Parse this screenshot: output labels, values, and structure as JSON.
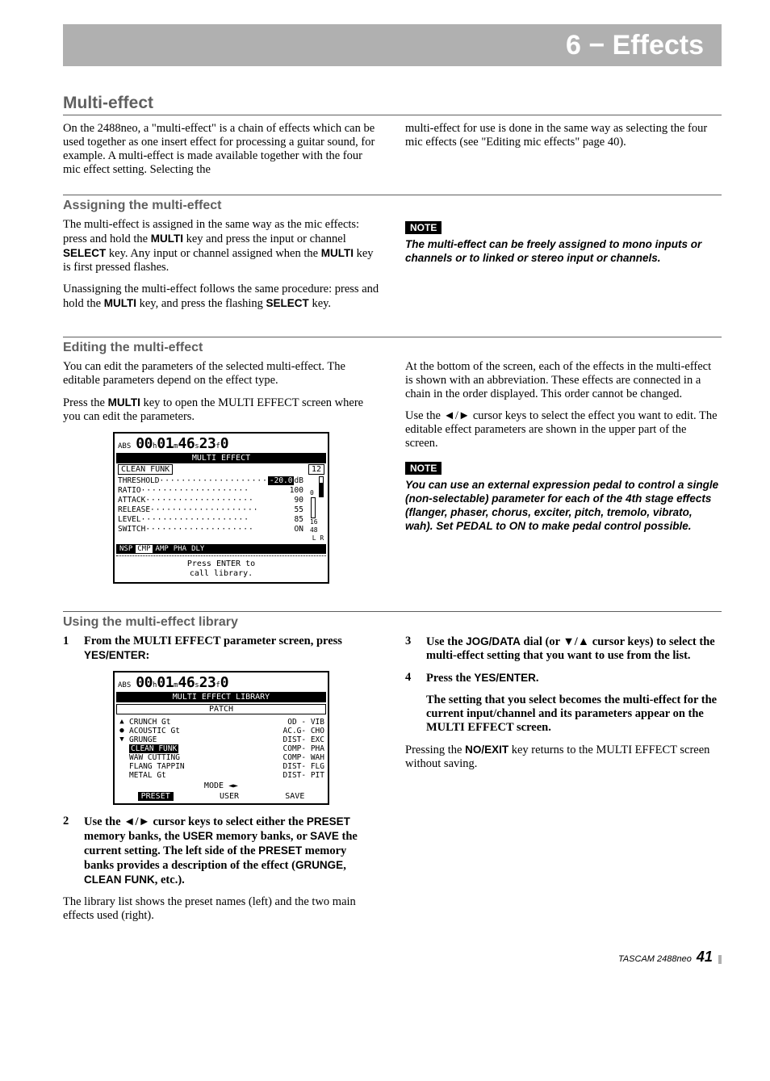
{
  "chapter": "6 − Effects",
  "section_multi": {
    "title": "Multi-effect",
    "p1": "On the 2488neo, a \"multi-effect\" is a chain of effects which can be used together as one insert effect for processing a guitar sound, for example. A multi-effect is made available together with the four mic effect setting. Selecting the",
    "p2": "multi-effect for use is done in the same way as selecting the four mic effects (see \"Editing mic effects\" page 40)."
  },
  "section_assign": {
    "title": "Assigning the multi-effect",
    "p1a": "The multi-effect is assigned in the same way as the mic effects: press and hold the ",
    "p1b": " key and press the input or channel ",
    "p1c": " key. Any input or channel assigned when the ",
    "p1d": " key is first pressed flashes.",
    "p2a": "Unassigning the multi-effect follows the same procedure: press and hold the ",
    "p2b": " key, and press the flashing ",
    "p2c": " key.",
    "k_multi": "MULTI",
    "k_select": "SELECT",
    "note_label": "NOTE",
    "note": "The multi-effect can be freely assigned to mono inputs or channels or to linked or stereo input or channels."
  },
  "section_edit": {
    "title": "Editing the multi-effect",
    "p1": "You can edit the parameters of the selected multi-effect. The editable parameters depend on the effect type.",
    "p2a": "Press the ",
    "p2b": " key to open the MULTI EFFECT screen where you can edit the parameters.",
    "k_multi": "MULTI",
    "p3": "At the bottom of the screen, each of the effects in the multi-effect is shown with an abbreviation. These effects are connected in a chain in the order displayed. This order cannot be changed.",
    "p4": "Use the ◄/► cursor keys to select the effect you want to edit. The editable effect parameters are shown in the upper part of the screen.",
    "note_label": "NOTE",
    "note": "You can use an external expression pedal to control a single (non-selectable) parameter for each of the 4th stage effects (flanger, phaser, chorus, exciter, pitch, tremolo, vibrato, wah). Set PEDAL to ON to make pedal control possible."
  },
  "section_lib": {
    "title": "Using the multi-effect library",
    "step1a": "From the MULTI EFFECT parameter screen, press ",
    "step1b": ":",
    "k_yes": "YES/ENTER",
    "step2a": "Use the ◄/► cursor keys to select either the ",
    "step2b": " memory banks, the ",
    "step2c": " memory banks, or ",
    "step2d": " the current setting. The left side of the ",
    "step2e": " memory banks provides a description of the effect (",
    "step2f": ", etc.).",
    "k_preset": "PRESET",
    "k_user": "USER",
    "k_save": "SAVE",
    "k_grunge": "GRUNGE",
    "k_clean": "CLEAN FUNK",
    "p_after2": "The library list shows the preset names (left) and the two main effects used (right).",
    "step3a": "Use the ",
    "step3b": " dial (or ▼/▲ cursor keys) to select the multi-effect setting that you want to use from the list.",
    "k_jog": "JOG/DATA",
    "step4a": "Press the ",
    "step4b": ".",
    "step4_after": "The setting that you select becomes the multi-effect for the current input/channel and its parameters appear on the MULTI EFFECT screen.",
    "p_last_a": "Pressing the ",
    "p_last_b": " key returns to the MULTI EFFECT screen without saving.",
    "k_no": "NO/EXIT"
  },
  "screen1": {
    "abs": "ABS",
    "time_h": "00",
    "u_h": "h",
    "time_m": "01",
    "u_m": "m",
    "time_s": "46",
    "u_s": "s",
    "time_f": "23",
    "u_f": "f",
    "time_sub": "0",
    "title": "MULTI EFFECT",
    "patch": "CLEAN FUNK",
    "patch_num": "12",
    "params": [
      {
        "n": "THRESHOLD",
        "v": "-20.0",
        "unit": "dB",
        "hl": true
      },
      {
        "n": "RATIO",
        "v": "100"
      },
      {
        "n": "ATTACK",
        "v": "90"
      },
      {
        "n": "RELEASE",
        "v": "55"
      },
      {
        "n": "LEVEL",
        "v": "85"
      },
      {
        "n": "SWITCH",
        "v": "ON"
      }
    ],
    "meter_ticks": [
      "0",
      "16",
      "48"
    ],
    "meter_lr": "L  R",
    "chain": [
      "NSP",
      "CMP",
      "AMP",
      "PHA",
      "DLY"
    ],
    "chain_sel": 1,
    "msg1": "Press ENTER to",
    "msg2": "call library."
  },
  "screen2": {
    "abs": "ABS",
    "time_h": "00",
    "u_h": "h",
    "time_m": "01",
    "u_m": "m",
    "time_s": "46",
    "u_s": "s",
    "time_f": "23",
    "u_f": "f",
    "time_sub": "0",
    "title": "MULTI EFFECT LIBRARY",
    "col_hdr": "PATCH",
    "rows": [
      {
        "n": "CRUNCH Gt",
        "r": "OD - VIB"
      },
      {
        "n": "ACOUSTIC Gt",
        "r": "AC.G- CHO"
      },
      {
        "n": "GRUNGE",
        "r": "DIST- EXC"
      },
      {
        "n": "CLEAN FUNK",
        "r": "COMP- PHA",
        "sel": true
      },
      {
        "n": "WAW CUTTING",
        "r": "COMP- WAH"
      },
      {
        "n": "FLANG TAPPIN",
        "r": "DIST- FLG"
      },
      {
        "n": "METAL Gt",
        "r": "DIST- PIT"
      }
    ],
    "mode_hdr": "MODE ◄►",
    "modes": [
      "PRESET",
      "USER",
      "SAVE"
    ],
    "mode_sel": 0
  },
  "footer": {
    "brand": "TASCAM 2488neo",
    "page": "41"
  }
}
